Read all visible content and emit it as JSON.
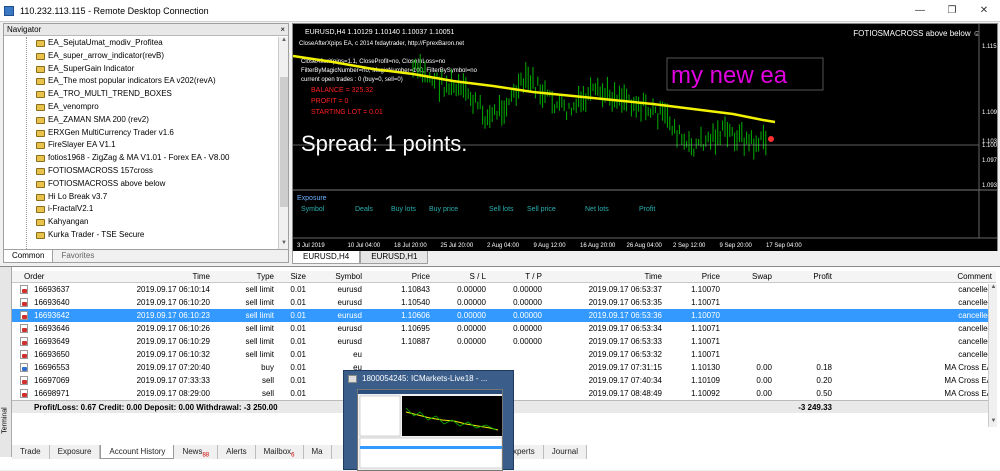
{
  "window": {
    "title": "110.232.113.115 - Remote Desktop Connection",
    "minimize": "—",
    "restore": "❐",
    "close": "✕"
  },
  "navigator": {
    "title": "Navigator",
    "close": "×",
    "items": [
      "EA_SejutaUmat_modiv_Profitea",
      "EA_super_arrow_indicator(revB)",
      "EA_SuperGain Indicator",
      "EA_The most popular indicators EA v202(revA)",
      "EA_TRO_MULTI_TREND_BOXES",
      "EA_venompro",
      "EA_ZAMAN SMA 200 (rev2)",
      "ERXGen MultiCurrency Trader v1.6",
      "FireSlayer EA V1.1",
      "fotios1968 - ZigZag & MA V1.01 - Forex EA - V8.00",
      "FOTIOSMACROSS 157cross",
      "FOTIOSMACROSS above below",
      "Hi Lo Break v3.7",
      "i-FractalV2.1",
      "Kahyangan",
      "Kurka Trader - TSE Secure"
    ],
    "tabs": [
      "Common",
      "Favorites"
    ]
  },
  "chart": {
    "header": "EURUSD,H4  1.10129 1.10140 1.10037 1.10051",
    "ea_label": "FOTIOSMACROSS above below ☺",
    "info_lines": [
      "CloseAfterXpips EA, c 2014 fxdaytrader, http://FprexBaron.net"
    ],
    "overlay_red": [
      "CloseAfterXpips=1.1, CloseProfit=no, CloseInLoss=no",
      "FilterByMagicNumber=no, MagicNumber=100, FilterBySymbol=no",
      "current open trades : 0 (buy=0, sell=0)"
    ],
    "status_lines": [
      "BALANCE = 325.32",
      "PROFIT = 0",
      "STARTING LOT = 0.01"
    ],
    "spread_text": "Spread: 1 points.",
    "watermark": "my new ea",
    "price_labels": [
      "1.115",
      "1.109",
      "1.103",
      "1.100",
      "1.097",
      "1.093"
    ],
    "date_labels": [
      "3 Jul 2019",
      "10 Jul 04:00",
      "18 Jul 20:00",
      "25 Jul 20:00",
      "2 Aug 04:00",
      "9 Aug 12:00",
      "16 Aug 20:00",
      "26 Aug 04:00",
      "2 Sep 12:00",
      "9 Sep 20:00",
      "17 Sep 04:00"
    ],
    "exposure_title": "Exposure",
    "exposure_cols": [
      "Symbol",
      "Deals",
      "Buy lots",
      "Buy price",
      "Sell lots",
      "Sell price",
      "Net lots",
      "Profit"
    ]
  },
  "chart_tabs": [
    "EURUSD,H4",
    "EURUSD,H1"
  ],
  "terminal": {
    "side_label": "Terminal",
    "columns": [
      "Order",
      "Time",
      "Type",
      "Size",
      "Symbol",
      "Price",
      "S / L",
      "T / P",
      "Time",
      "Price",
      "Swap",
      "Profit",
      "Comment"
    ],
    "rows": [
      {
        "order": "16693637",
        "t1": "2019.09.17 06:10:14",
        "type": "sell limit",
        "size": "0.01",
        "symbol": "eurusd",
        "price": "1.10843",
        "sl": "0.00000",
        "tp": "0.00000",
        "t2": "2019.09.17 06:53:37",
        "price2": "1.10070",
        "swap": "",
        "profit": "",
        "comment": "cancelled"
      },
      {
        "order": "16693640",
        "t1": "2019.09.17 06:10:20",
        "type": "sell limit",
        "size": "0.01",
        "symbol": "eurusd",
        "price": "1.10540",
        "sl": "0.00000",
        "tp": "0.00000",
        "t2": "2019.09.17 06:53:35",
        "price2": "1.10071",
        "swap": "",
        "profit": "",
        "comment": "cancelled"
      },
      {
        "order": "16693642",
        "t1": "2019.09.17 06:10:23",
        "type": "sell limit",
        "size": "0.01",
        "symbol": "eurusd",
        "price": "1.10606",
        "sl": "0.00000",
        "tp": "0.00000",
        "t2": "2019.09.17 06:53:36",
        "price2": "1.10070",
        "swap": "",
        "profit": "",
        "comment": "cancelled"
      },
      {
        "order": "16693646",
        "t1": "2019.09.17 06:10:26",
        "type": "sell limit",
        "size": "0.01",
        "symbol": "eurusd",
        "price": "1.10695",
        "sl": "0.00000",
        "tp": "0.00000",
        "t2": "2019.09.17 06:53:34",
        "price2": "1.10071",
        "swap": "",
        "profit": "",
        "comment": "cancelled"
      },
      {
        "order": "16693649",
        "t1": "2019.09.17 06:10:29",
        "type": "sell limit",
        "size": "0.01",
        "symbol": "eurusd",
        "price": "1.10887",
        "sl": "0.00000",
        "tp": "0.00000",
        "t2": "2019.09.17 06:53:33",
        "price2": "1.10071",
        "swap": "",
        "profit": "",
        "comment": "cancelled"
      },
      {
        "order": "16693650",
        "t1": "2019.09.17 06:10:32",
        "type": "sell limit",
        "size": "0.01",
        "symbol": "eu",
        "price": "",
        "sl": "",
        "tp": "",
        "t2": "2019.09.17 06:53:32",
        "price2": "1.10071",
        "swap": "",
        "profit": "",
        "comment": "cancelled"
      },
      {
        "order": "16696553",
        "t1": "2019.09.17 07:20:40",
        "type": "buy",
        "size": "0.01",
        "symbol": "eu",
        "price": "",
        "sl": "",
        "tp": "",
        "t2": "2019.09.17 07:31:15",
        "price2": "1.10130",
        "swap": "0.00",
        "profit": "0.18",
        "comment": "MA Cross EA"
      },
      {
        "order": "16697069",
        "t1": "2019.09.17 07:33:33",
        "type": "sell",
        "size": "0.01",
        "symbol": "eu",
        "price": "",
        "sl": "",
        "tp": "",
        "t2": "2019.09.17 07:40:34",
        "price2": "1.10109",
        "swap": "0.00",
        "profit": "0.20",
        "comment": "MA Cross EA"
      },
      {
        "order": "16698971",
        "t1": "2019.09.17 08:29:00",
        "type": "sell",
        "size": "0.01",
        "symbol": "eu",
        "price": "",
        "sl": "",
        "tp": "",
        "t2": "2019.09.17 08:48:49",
        "price2": "1.10092",
        "swap": "0.00",
        "profit": "0.50",
        "comment": "MA Cross EA"
      }
    ],
    "total": {
      "label": "Profit/Loss: 0.67  Credit: 0.00  Deposit: 0.00  Withdrawal: -3 250.00",
      "value": "-3 249.33"
    },
    "tabs": [
      "Trade",
      "Exposure",
      "Account History",
      "News",
      "Alerts",
      "Mailbox",
      "Ma"
    ],
    "tabs_right": [
      "Experts",
      "Journal"
    ],
    "news_badge": "88",
    "mail_badge": "6"
  },
  "taskbar_preview": {
    "title": "1800054245: ICMarkets-Live18 - ..."
  },
  "colors": {
    "sel": "#3399ff",
    "ma_line": "#f2f200",
    "candles": "#00b000",
    "watermark": "#e000e0"
  }
}
